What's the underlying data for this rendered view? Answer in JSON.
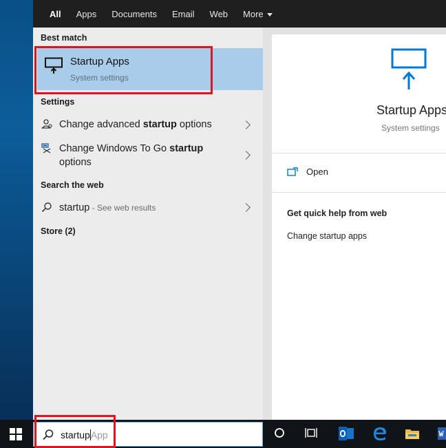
{
  "tabs": [
    "All",
    "Apps",
    "Documents",
    "Email",
    "Web",
    "More"
  ],
  "sections": {
    "best_match": "Best match",
    "settings": "Settings",
    "search_web": "Search the web",
    "store": "Store (2)"
  },
  "best_match": {
    "title": "Startup Apps",
    "subtitle": "System settings"
  },
  "settings_items": [
    {
      "pre": "Change advanced ",
      "bold": "startup",
      "post": " options"
    },
    {
      "pre": "Change Windows To Go ",
      "bold": "startup",
      "post": "",
      "line2": "options"
    }
  ],
  "web_item": {
    "query": "startup",
    "suffix": " - See web results"
  },
  "preview": {
    "title": "Startup Apps",
    "subtitle": "System settings",
    "open_label": "Open",
    "help_title": "Get quick help from web",
    "help_link": "Change startup apps"
  },
  "search_box": {
    "typed": "startup",
    "hint": "App"
  },
  "icons": {
    "best": "monitor-arrow-icon",
    "setting1": "user-settings-icon",
    "setting2": "usb-drive-icon",
    "web": "search-icon",
    "open": "open-window-icon",
    "taskbar": [
      "windows-logo-icon",
      "cortana-icon",
      "task-view-icon",
      "outlook-icon",
      "edge-icon",
      "file-explorer-icon",
      "word-icon"
    ]
  },
  "colors": {
    "selection": "#a8cce9",
    "accent": "#0078d7",
    "highlight_box": "#e3121e"
  }
}
